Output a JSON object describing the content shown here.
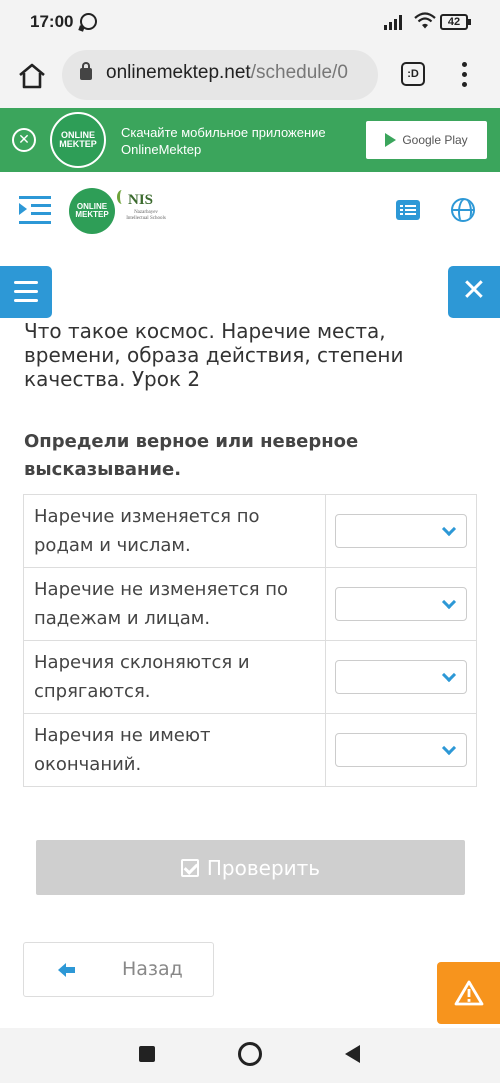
{
  "status_bar": {
    "time": "17:00",
    "battery": "42"
  },
  "browser": {
    "url_host": "onlinemektep.net",
    "url_path": "/schedule/0",
    "tabs_label": ":D"
  },
  "promo": {
    "logo_line1": "ONLINE",
    "logo_line2": "MEKTEP",
    "line1": "Скачайте мобильное приложение",
    "line2": "OnlineMektep",
    "store_label": "Google Play",
    "color": "#3ba55c"
  },
  "header": {
    "logo_line1": "ONLINE",
    "logo_line2": "MEKTEP",
    "nis_title": "NIS",
    "nis_sub": "Nazarbayev Intellectual Schools"
  },
  "lesson": {
    "title": "Что такое космос. Наречие места, времени, образа действия, степени качества. Урок 2",
    "task": "Определи верное или неверное высказывание."
  },
  "statements": [
    {
      "text": "Наречие изменяется по родам и числам.",
      "selected": ""
    },
    {
      "text": "Наречие не изменяется по падежам и лицам.",
      "selected": ""
    },
    {
      "text": "Наречия склоняются и спрягаются.",
      "selected": ""
    },
    {
      "text": "Наречия не имеют окончаний.",
      "selected": ""
    }
  ],
  "actions": {
    "check_label": "Проверить",
    "back_label": "Назад"
  },
  "colors": {
    "accent": "#2d98d6",
    "warning": "#f7941d",
    "disabled": "#cfcfcf"
  },
  "icons": [
    "whatsapp-icon",
    "signal-icon",
    "wifi-icon",
    "battery-icon",
    "home-icon",
    "lock-icon",
    "menu-dots-icon",
    "close-icon",
    "play-store-icon",
    "indent-menu-icon",
    "list-icon",
    "globe-icon",
    "hamburger-icon",
    "chevron-down-icon",
    "checkbox-icon",
    "arrow-left-icon",
    "warning-icon"
  ]
}
